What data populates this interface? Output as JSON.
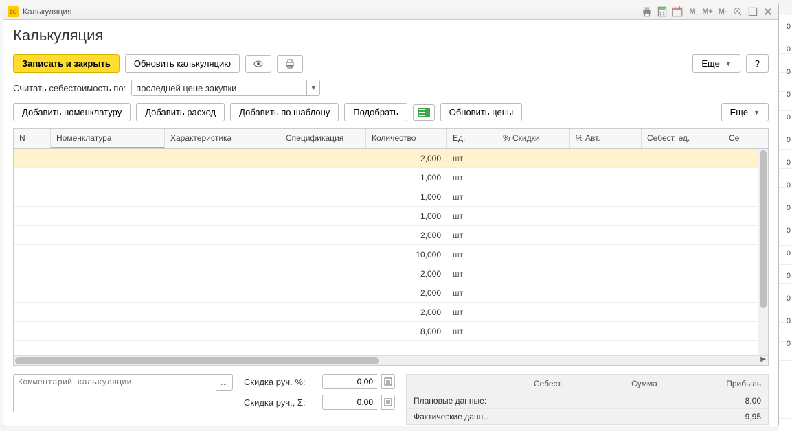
{
  "window": {
    "title": "Калькуляция"
  },
  "page": {
    "title": "Калькуляция"
  },
  "toolbar1": {
    "save_close": "Записать и закрыть",
    "refresh_calc": "Обновить калькуляцию",
    "more": "Еще",
    "help": "?"
  },
  "cost_basis": {
    "label": "Считать себестоимость по:",
    "value": "последней цене закупки"
  },
  "toolbar2": {
    "add_nom": "Добавить номенклатуру",
    "add_expense": "Добавить расход",
    "add_template": "Добавить по шаблону",
    "pick": "Подобрать",
    "refresh_prices": "Обновить цены",
    "more": "Еще"
  },
  "table": {
    "headers": {
      "n": "N",
      "nom": "Номенклатура",
      "char": "Характеристика",
      "spec": "Спецификация",
      "qty": "Количество",
      "unit": "Ед.",
      "disc": "% Скидки",
      "avt": "% Авт.",
      "costu": "Себест. ед.",
      "last": "Се"
    },
    "rows": [
      {
        "qty": "2,000",
        "unit": "шт"
      },
      {
        "qty": "1,000",
        "unit": "шт"
      },
      {
        "qty": "1,000",
        "unit": "шт"
      },
      {
        "qty": "1,000",
        "unit": "шт"
      },
      {
        "qty": "2,000",
        "unit": "шт"
      },
      {
        "qty": "10,000",
        "unit": "шт"
      },
      {
        "qty": "2,000",
        "unit": "шт"
      },
      {
        "qty": "2,000",
        "unit": "шт"
      },
      {
        "qty": "2,000",
        "unit": "шт"
      },
      {
        "qty": "8,000",
        "unit": "шт"
      }
    ]
  },
  "comment": {
    "placeholder": "Комментарий калькуляции"
  },
  "discount": {
    "pct_label": "Скидка руч. %:",
    "pct_value": "0,00",
    "sum_label": "Скидка руч., Σ:",
    "sum_value": "0,00"
  },
  "summary": {
    "head": {
      "cost": "Себест.",
      "sum": "Сумма",
      "profit": "Прибыль"
    },
    "plan": {
      "label": "Плановые данные:",
      "profit": "8,00"
    },
    "fact": {
      "label": "Фактические данн…",
      "profit": "9,95"
    }
  },
  "behind": [
    "0",
    "0",
    "0",
    "0",
    "0",
    "0",
    "0",
    "0",
    "0",
    "0",
    "0",
    "0",
    "0",
    "0",
    "0"
  ]
}
